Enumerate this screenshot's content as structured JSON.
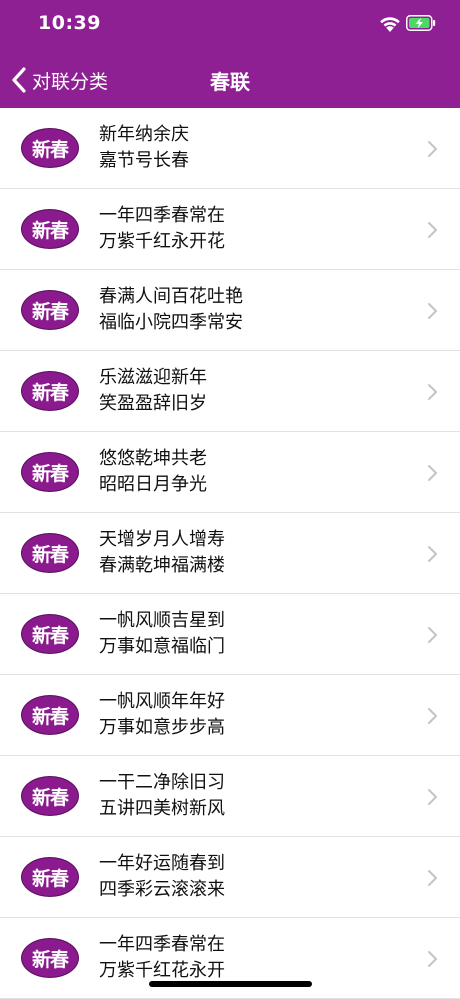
{
  "status_bar": {
    "time": "10:39"
  },
  "nav": {
    "back_label": "对联分类",
    "title": "春联"
  },
  "badge_label": "新春",
  "colors": {
    "brand": "#8e2093",
    "badge": "#8a1a8e",
    "battery": "#4cd964"
  },
  "icons": {
    "back": "chevron-left-icon",
    "row_disclosure": "chevron-right-icon",
    "wifi": "wifi-icon",
    "battery": "battery-charging-icon"
  },
  "couplets": [
    {
      "line1": "新年纳余庆",
      "line2": "嘉节号长春"
    },
    {
      "line1": "一年四季春常在",
      "line2": "万紫千红永开花"
    },
    {
      "line1": "春满人间百花吐艳",
      "line2": "福临小院四季常安"
    },
    {
      "line1": "乐滋滋迎新年",
      "line2": "笑盈盈辞旧岁"
    },
    {
      "line1": "悠悠乾坤共老",
      "line2": "昭昭日月争光"
    },
    {
      "line1": "天增岁月人增寿",
      "line2": "春满乾坤福满楼"
    },
    {
      "line1": "一帆风顺吉星到",
      "line2": "万事如意福临门"
    },
    {
      "line1": "一帆风顺年年好",
      "line2": "万事如意步步高"
    },
    {
      "line1": "一干二净除旧习",
      "line2": "五讲四美树新风"
    },
    {
      "line1": "一年好运随春到",
      "line2": "四季彩云滚滚来"
    },
    {
      "line1": "一年四季春常在",
      "line2": "万紫千红花永开"
    }
  ]
}
